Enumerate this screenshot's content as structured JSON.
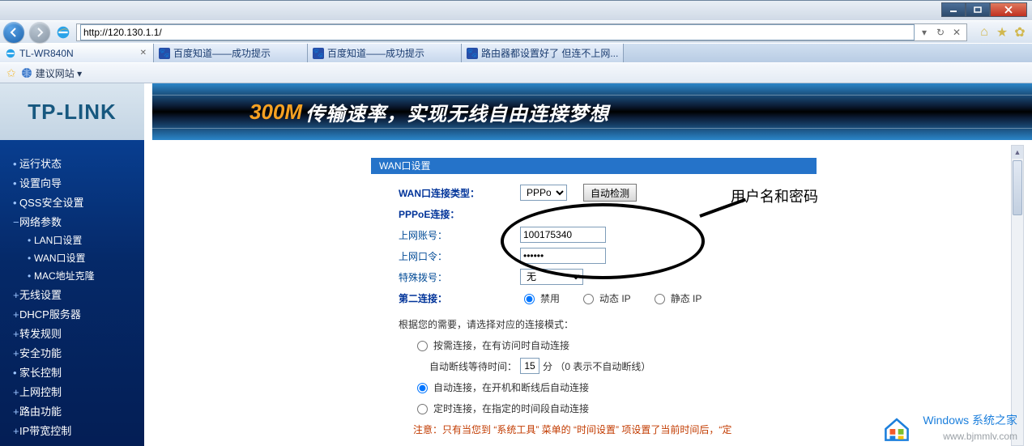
{
  "window": {
    "url": "http://120.130.1.1/"
  },
  "tabs": [
    {
      "label": "TL-WR840N",
      "active": true,
      "icon": "ie"
    },
    {
      "label": "百度知道——成功提示",
      "active": false,
      "icon": "paw"
    },
    {
      "label": "百度知道——成功提示",
      "active": false,
      "icon": "paw"
    },
    {
      "label": "路由器都设置好了 但连不上网...",
      "active": false,
      "icon": "paw"
    }
  ],
  "favorites": {
    "suggest_label": "建议网站 ▾"
  },
  "brand": "TP-LINK",
  "banner": {
    "num": "300M",
    "text": "传输速率，实现无线自由连接梦想"
  },
  "sidebar": {
    "items": [
      {
        "bullet": "•",
        "label": "运行状态"
      },
      {
        "bullet": "•",
        "label": "设置向导"
      },
      {
        "bullet": "•",
        "label": "QSS安全设置"
      },
      {
        "bullet": "−",
        "label": "网络参数",
        "children": [
          {
            "bullet": "•",
            "label": "LAN口设置"
          },
          {
            "bullet": "•",
            "label": "WAN口设置"
          },
          {
            "bullet": "•",
            "label": "MAC地址克隆"
          }
        ]
      },
      {
        "bullet": "+",
        "label": "无线设置"
      },
      {
        "bullet": "+",
        "label": "DHCP服务器"
      },
      {
        "bullet": "+",
        "label": "转发规则"
      },
      {
        "bullet": "+",
        "label": "安全功能"
      },
      {
        "bullet": "•",
        "label": "家长控制"
      },
      {
        "bullet": "+",
        "label": "上网控制"
      },
      {
        "bullet": "+",
        "label": "路由功能"
      },
      {
        "bullet": "+",
        "label": "IP带宽控制"
      }
    ]
  },
  "panel": {
    "title": "WAN口设置",
    "conn_type_label": "WAN口连接类型：",
    "conn_type_value": "PPPoE",
    "autodetect_btn": "自动检测",
    "pppoe_label": "PPPoE连接：",
    "account_label": "上网账号：",
    "account_value": "100175340",
    "password_label": "上网口令：",
    "password_value": "••••••",
    "special_label": "特殊拨号：",
    "special_value": "无",
    "second_conn_label": "第二连接：",
    "radios": {
      "disable": "禁用",
      "dyn": "动态 IP",
      "stat": "静态 IP"
    },
    "mode_hint": "根据您的需要，请选择对应的连接模式：",
    "opt1": "按需连接，在有访问时自动连接",
    "opt1_sub_a": "自动断线等待时间：",
    "opt1_sub_val": "15",
    "opt1_sub_b": "分 （0 表示不自动断线）",
    "opt2": "自动连接，在开机和断线后自动连接",
    "opt3": "定时连接，在指定的时间段自动连接",
    "note": "注意：只有当您到 “系统工具” 菜单的 “时间设置” 项设置了当前时间后，“定"
  },
  "annotation": {
    "text": "用户名和密码"
  },
  "watermark": {
    "title": "Windows 系统之家",
    "url": "www.bjmmlv.com"
  }
}
